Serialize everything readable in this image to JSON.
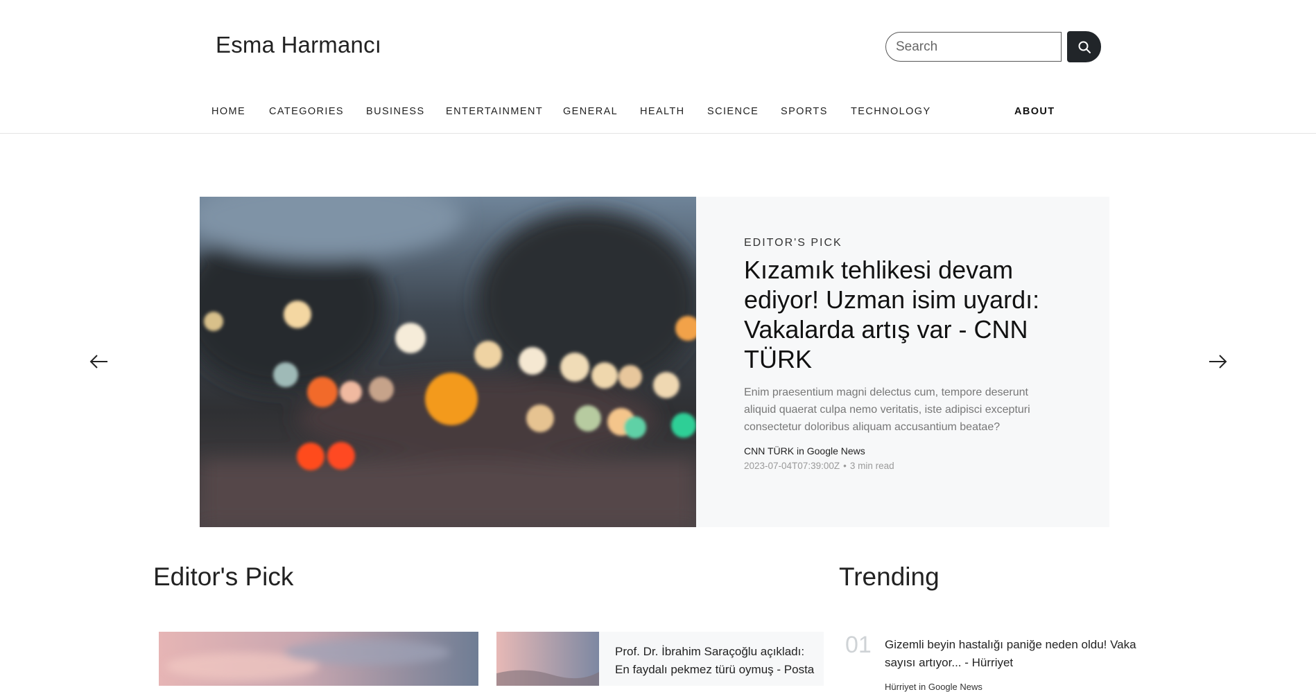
{
  "site": {
    "title": "Esma Harmancı"
  },
  "search": {
    "placeholder": "Search"
  },
  "nav": {
    "items": [
      "HOME",
      "CATEGORIES",
      "BUSINESS",
      "ENTERTAINMENT",
      "GENERAL",
      "HEALTH",
      "SCIENCE",
      "SPORTS",
      "TECHNOLOGY"
    ],
    "about": "ABOUT"
  },
  "hero": {
    "kicker": "EDITOR'S PICK",
    "title": "Kızamık tehlikesi devam ediyor! Uzman isim uyardı: Vakalarda artış var - CNN TÜRK",
    "excerpt": "Enim praesentium magni delectus cum, tempore deserunt aliquid quaerat culpa nemo veritatis, iste adipisci excepturi consectetur doloribus aliquam accusantium beatae?",
    "source": "CNN TÜRK in Google News",
    "date": "2023-07-04T07:39:00Z",
    "separator": "•",
    "read_time": "3 min read"
  },
  "sections": {
    "editors_pick": "Editor's Pick",
    "trending": "Trending"
  },
  "editors_pick": {
    "small_card_title": "Prof. Dr. İbrahim Saraçoğlu açıkladı: En faydalı pekmez türü oymuş - Posta"
  },
  "trending": {
    "items": [
      {
        "number": "01",
        "title": "Gizemli beyin hastalığı paniğe neden oldu! Vaka sayısı artıyor... - Hürriyet",
        "source": "Hürriyet in Google News"
      }
    ]
  },
  "colors": {
    "accent_dark": "#212529",
    "panel_bg": "#f7f8f9"
  },
  "icons": {
    "search": "search-icon",
    "prev": "arrow-left-icon",
    "next": "arrow-right-icon"
  }
}
